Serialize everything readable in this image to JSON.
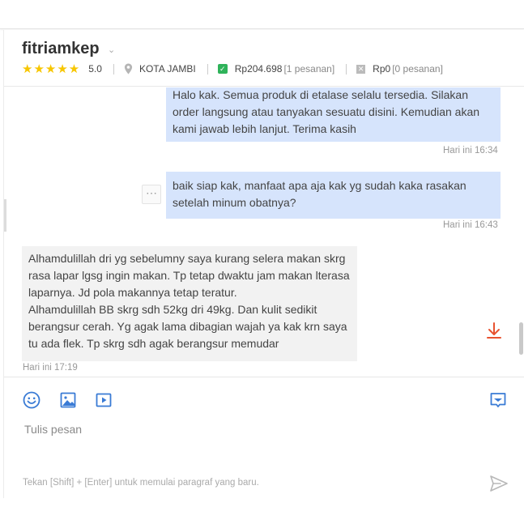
{
  "header": {
    "shop_name": "fitriamkep",
    "rating": "5.0",
    "location": "KOTA JAMBI",
    "sales_amount": "Rp204.698",
    "sales_count": "[1 pesanan]",
    "refund_amount": "Rp0",
    "refund_count": "[0 pesanan]",
    "stars": "★★★★★"
  },
  "messages": [
    {
      "lines": [
        "Halo kak. Semua produk di etalase selalu tersedia. Silakan",
        "order langsung atau tanyakan sesuatu disini. Kemudian akan",
        "kami jawab lebih lanjut. Terima kasih"
      ],
      "time": "Hari ini 16:34"
    },
    {
      "lines": [
        "baik siap kak, manfaat apa aja kak yg sudah kaka rasakan",
        "setelah minum obatnya?"
      ],
      "time": "Hari ini 16:43"
    },
    {
      "lines": [
        "Alhamdulillah dri yg sebelumny saya kurang selera makan skrg",
        "rasa lapar lgsg ingin makan. Tp tetap dwaktu jam makan lterasa",
        "laparnya. Jd pola makannya tetap teratur.",
        "Alhamdulillah BB skrg sdh 52kg dri 49kg. Dan kulit sedikit",
        "berangsur cerah. Yg agak lama dibagian wajah ya kak krn saya",
        "tu ada flek. Tp skrg sdh agak berangsur memudar"
      ],
      "time": "Hari ini 17:19"
    }
  ],
  "composer": {
    "placeholder": "Tulis pesan",
    "hint": "Tekan [Shift] + [Enter] untuk memulai paragraf yang baru."
  },
  "icons": {
    "more": "⋯",
    "caret": "⌄",
    "check": "✓",
    "cross": "✕"
  },
  "colors": {
    "accent": "#42b549",
    "icon_blue": "#3a7bd5",
    "download_red": "#e8522f",
    "star_yellow": "#f7c600",
    "my_bubble": "#d6e4fc"
  }
}
